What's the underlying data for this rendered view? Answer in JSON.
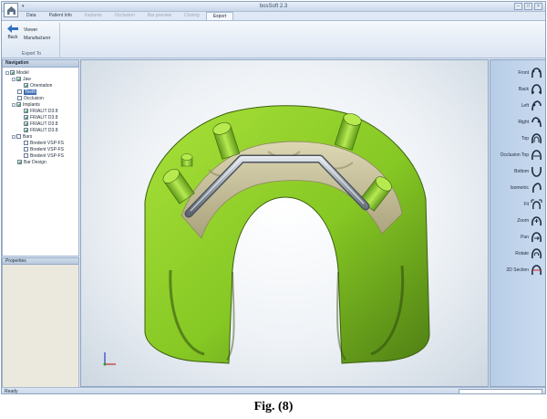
{
  "app": {
    "title": "bosSoft 2.3"
  },
  "tabs": [
    {
      "label": "Data",
      "state": "normal"
    },
    {
      "label": "Patient Info",
      "state": "normal"
    },
    {
      "label": "Implants",
      "state": "disabled"
    },
    {
      "label": "Occlusion",
      "state": "disabled"
    },
    {
      "label": "Bar preview",
      "state": "disabled"
    },
    {
      "label": "Closing",
      "state": "disabled"
    },
    {
      "label": "Export",
      "state": "active"
    }
  ],
  "ribbon": {
    "back_label": "Back",
    "viewer_label": "Viewer",
    "manufacturer_label": "Manufacturer",
    "group_label": "Export To"
  },
  "navigation": {
    "header": "Navigation",
    "items": [
      {
        "label": "Model",
        "checked": true,
        "level": 0,
        "expander": "-",
        "selected": false
      },
      {
        "label": "Jaw",
        "checked": true,
        "level": 1,
        "expander": "-",
        "selected": false
      },
      {
        "label": "Orientation",
        "checked": true,
        "level": 2,
        "expander": "",
        "selected": false
      },
      {
        "label": "Teeth",
        "checked": false,
        "level": 1,
        "expander": "",
        "selected": true
      },
      {
        "label": "Occlusion",
        "checked": false,
        "level": 1,
        "expander": "",
        "selected": false
      },
      {
        "label": "Implants",
        "checked": true,
        "level": 0,
        "expander": "-",
        "selected": false
      },
      {
        "label": "FRIALIT D3.8",
        "checked": true,
        "level": 1,
        "expander": "",
        "selected": false
      },
      {
        "label": "FRIALIT D3.8",
        "checked": true,
        "level": 1,
        "expander": "",
        "selected": false
      },
      {
        "label": "FRIALIT D3.8",
        "checked": true,
        "level": 1,
        "expander": "",
        "selected": false
      },
      {
        "label": "FRIALIT D3.8",
        "checked": true,
        "level": 1,
        "expander": "",
        "selected": false
      },
      {
        "label": "Bars",
        "checked": false,
        "level": 0,
        "expander": "-",
        "selected": false
      },
      {
        "label": "Bredent VSP-FS",
        "checked": false,
        "level": 1,
        "expander": "",
        "selected": false
      },
      {
        "label": "Bredent VSP-FS",
        "checked": false,
        "level": 1,
        "expander": "",
        "selected": false
      },
      {
        "label": "Bredent VSP-FS",
        "checked": false,
        "level": 1,
        "expander": "",
        "selected": false
      },
      {
        "label": "Bar Design",
        "checked": true,
        "level": 0,
        "expander": "",
        "selected": false
      }
    ]
  },
  "properties": {
    "header": "Properties"
  },
  "views": [
    "Front",
    "Back",
    "Left",
    "Right",
    "Top",
    "Occlusion Top",
    "Bottom",
    "Isometric",
    "Fit",
    "Zoom",
    "Pan",
    "Rotate",
    "2D Section"
  ],
  "status": {
    "text": "Ready"
  },
  "caption": "Fig. (8)",
  "colors": {
    "model_green": "#8fcf2a",
    "tissue_beige": "#c9c29a",
    "bar_gray": "#9aa3ad",
    "selection_blue": "#3d6fb6"
  }
}
